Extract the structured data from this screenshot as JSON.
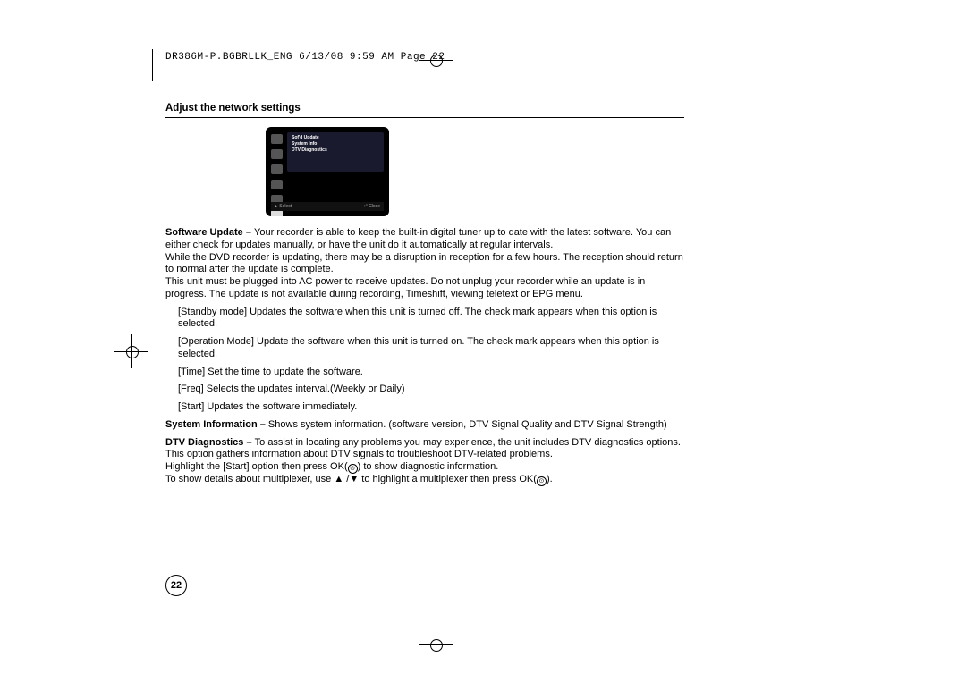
{
  "header": "DR386M-P.BGBRLLK_ENG  6/13/08  9:59 AM  Page 22",
  "section_title": "Adjust the network settings",
  "screenshot": {
    "menu_items": [
      "Sof'd Update",
      "System Info",
      "DTV Diagnostics"
    ],
    "footer_left": "▶ Select",
    "footer_right": "⏎ Close"
  },
  "para_softupdate_lead": "Software Update – ",
  "para_softupdate": "Your recorder is able to keep the built-in digital tuner up to date with the latest software. You can either check for updates manually, or have the unit do it automatically at regular intervals.",
  "para_softupdate_2": "While the DVD recorder is updating, there may be a disruption in reception for a few hours. The reception should return to normal after the update is complete.",
  "para_softupdate_3": "This unit must be plugged into AC power to receive updates. Do not unplug your recorder while an update is in progress. The update is not available during recording, Timeshift, viewing teletext or EPG menu.",
  "opt_standby": "[Standby mode] Updates the software when this unit is turned off. The check mark appears when this option is selected.",
  "opt_operation": "[Operation Mode] Update the software when this unit is turned on. The check mark appears when this option is selected.",
  "opt_time": "[Time] Set the time to update the software.",
  "opt_freq": "[Freq] Selects the updates interval.(Weekly or Daily)",
  "opt_start": "[Start] Updates the software immediately.",
  "para_sysinfo_lead": "System Information  – ",
  "para_sysinfo": "Shows system information. (software version, DTV Signal Quality and DTV Signal Strength)",
  "para_dtv_lead": "DTV Diagnostics – ",
  "para_dtv": "To assist in locating any problems you may experience, the unit includes DTV diagnostics options. This option gathers information about DTV signals to troubleshoot DTV-related problems.",
  "para_dtv_2a": "Highlight the [Start] option then press OK(",
  "para_dtv_2b": ") to show diagnostic information.",
  "para_dtv_3a": "To show details about multiplexer, use ▲ /▼ to highlight a multiplexer then press OK(",
  "para_dtv_3b": ").",
  "ok_glyph": "⊙",
  "page_number": "22"
}
